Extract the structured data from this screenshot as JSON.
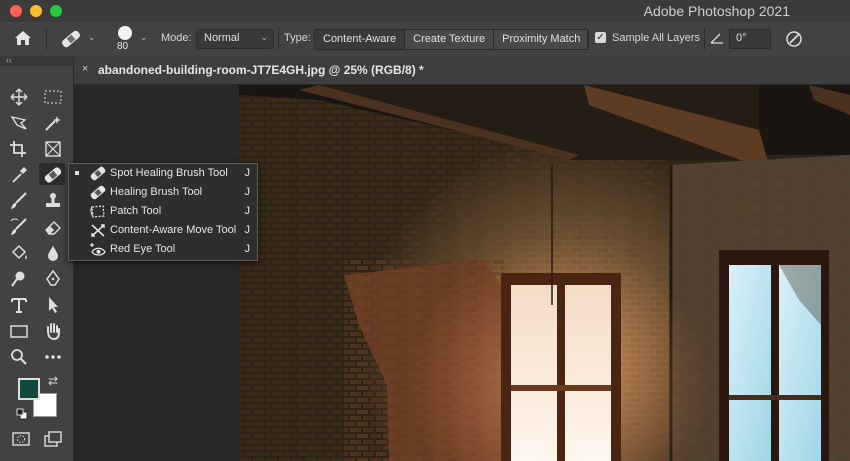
{
  "app": {
    "title": "Adobe Photoshop 2021"
  },
  "options_bar": {
    "brush_size": "80",
    "mode_label": "Mode:",
    "mode_value": "Normal",
    "type_label": "Type:",
    "type_options": [
      "Content-Aware",
      "Create Texture",
      "Proximity Match"
    ],
    "type_selected": "Content-Aware",
    "sample_all_layers_label": "Sample All Layers",
    "sample_all_layers_checked": true,
    "angle_value": "0°"
  },
  "document": {
    "tab_title": "abandoned-building-room-JT7E4GH.jpg @ 25% (RGB/8) *",
    "close_glyph": "×"
  },
  "toolbar": {
    "collapse_glyph": "‹‹",
    "foreground_color": "#0f4a3f",
    "background_color": "#ffffff"
  },
  "flyout": {
    "items": [
      {
        "label": "Spot Healing Brush Tool",
        "key": "J",
        "icon": "spot-healing-brush-icon",
        "active": true
      },
      {
        "label": "Healing Brush Tool",
        "key": "J",
        "icon": "healing-brush-icon",
        "active": false
      },
      {
        "label": "Patch Tool",
        "key": "J",
        "icon": "patch-icon",
        "active": false
      },
      {
        "label": "Content-Aware Move Tool",
        "key": "J",
        "icon": "content-aware-move-icon",
        "active": false
      },
      {
        "label": "Red Eye Tool",
        "key": "J",
        "icon": "red-eye-icon",
        "active": false
      }
    ]
  }
}
